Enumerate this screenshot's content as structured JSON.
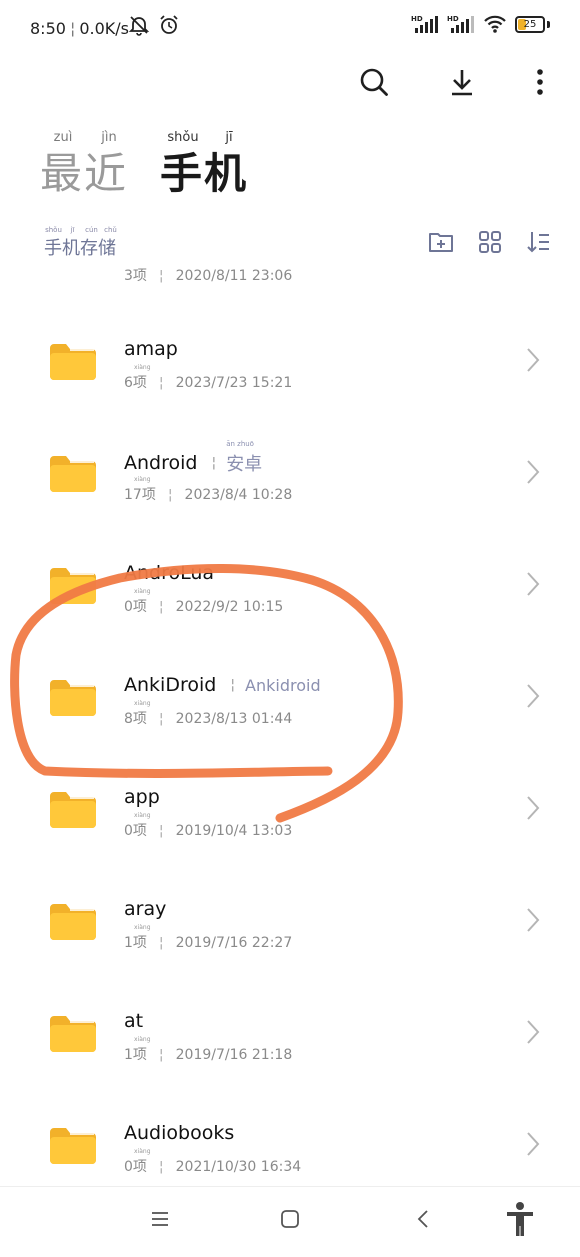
{
  "status_bar": {
    "time": "8:50",
    "speed": "0.0K/s",
    "battery": "25"
  },
  "toolbar": {
    "search_icon": "search-icon",
    "download_icon": "download-icon",
    "more_icon": "more-icon"
  },
  "tabs": [
    {
      "label": "最近",
      "pinyin": [
        "zuì",
        "jìn"
      ],
      "active": false
    },
    {
      "label": "手机",
      "pinyin": [
        "shǒu",
        "jī"
      ],
      "active": true
    }
  ],
  "path": {
    "label": "手机存储",
    "pinyin": [
      "shǒu",
      "jī",
      "cún",
      "chǔ"
    ]
  },
  "partial_item": {
    "count": "3项",
    "date": "2020/8/11 23:06"
  },
  "items": [
    {
      "name": "amap",
      "alias": "",
      "alias_pinyin": "",
      "count": "6项",
      "count_pinyin": "xiàng",
      "date": "2023/7/23 15:21"
    },
    {
      "name": "Android",
      "alias": "安卓",
      "alias_pinyin": "ān   zhuō",
      "count": "17项",
      "count_pinyin": "xiàng",
      "date": "2023/8/4 10:28"
    },
    {
      "name": "AndroLua",
      "alias": "",
      "alias_pinyin": "",
      "count": "0项",
      "count_pinyin": "xiàng",
      "date": "2022/9/2 10:15"
    },
    {
      "name": "AnkiDroid",
      "alias": "Ankidroid",
      "alias_pinyin": "",
      "count": "8项",
      "count_pinyin": "xiàng",
      "date": "2023/8/13 01:44"
    },
    {
      "name": "app",
      "alias": "",
      "alias_pinyin": "",
      "count": "0项",
      "count_pinyin": "xiàng",
      "date": "2019/10/4 13:03"
    },
    {
      "name": "aray",
      "alias": "",
      "alias_pinyin": "",
      "count": "1项",
      "count_pinyin": "xiàng",
      "date": "2019/7/16 22:27"
    },
    {
      "name": "at",
      "alias": "",
      "alias_pinyin": "",
      "count": "1项",
      "count_pinyin": "xiàng",
      "date": "2019/7/16 21:18"
    },
    {
      "name": "Audiobooks",
      "alias": "",
      "alias_pinyin": "",
      "count": "0项",
      "count_pinyin": "xiàng",
      "date": "2021/10/30 16:34"
    }
  ],
  "colors": {
    "folder": "#FFC83A",
    "folder_dark": "#F2B12A",
    "annotation": "#F07A45",
    "alias": "#8B90B0"
  }
}
